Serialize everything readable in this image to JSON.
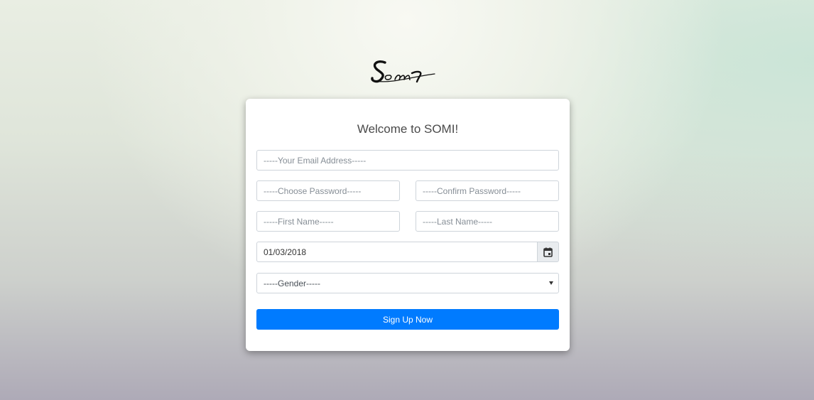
{
  "brand": {
    "logo_text": "Somi"
  },
  "form": {
    "title": "Welcome to SOMI!",
    "email_placeholder": "-----Your Email Address-----",
    "password_placeholder": "-----Choose Password-----",
    "confirm_placeholder": "-----Confirm Password-----",
    "first_name_placeholder": "-----First Name-----",
    "last_name_placeholder": "-----Last Name-----",
    "date_value": "01/03/2018",
    "date_icon": "calendar-icon",
    "gender_selected": "-----Gender-----",
    "submit_label": "Sign Up Now"
  },
  "colors": {
    "primary": "#007bff",
    "card_bg": "#ffffff",
    "title": "#4a4a4a"
  }
}
